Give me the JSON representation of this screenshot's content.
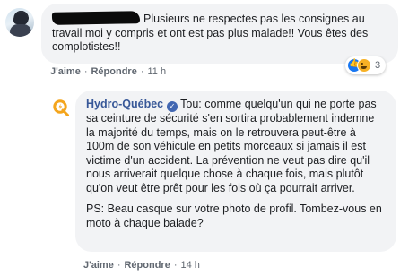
{
  "comment": {
    "body": "Plusieurs ne respectes pas les consignes au travail moi y compris et ont est pas plus malade!! Vous êtes des complotistes!!",
    "actions": {
      "like": "J'aime",
      "reply": "Répondre",
      "time": "11 h"
    },
    "reactions": {
      "icons": [
        "like-icon",
        "haha-icon"
      ],
      "count": "3"
    }
  },
  "reply": {
    "author": "Hydro-Québec",
    "paragraph_1": "Tou: comme quelqu'un qui ne porte pas sa ceinture de sécurité s'en sortira probablement indemne la majorité du temps, mais on le retrouvera peut-être à 100m de son véhicule en petits morceaux si jamais il est victime d'un accident. La prévention ne veut pas dire qu'il nous arriverait quelque chose à chaque fois, mais plutôt qu'on veut être prêt pour les fois où ça pourrait arriver.",
    "paragraph_2": "PS: Beau casque sur votre photo de profil. Tombez-vous en moto à chaque balade?",
    "actions": {
      "like": "J'aime",
      "reply": "Répondre",
      "time": "14 h"
    }
  },
  "colors": {
    "bubble": "#f2f3f5",
    "author": "#385898",
    "meta": "#606770",
    "brand": "#f4a51c"
  }
}
